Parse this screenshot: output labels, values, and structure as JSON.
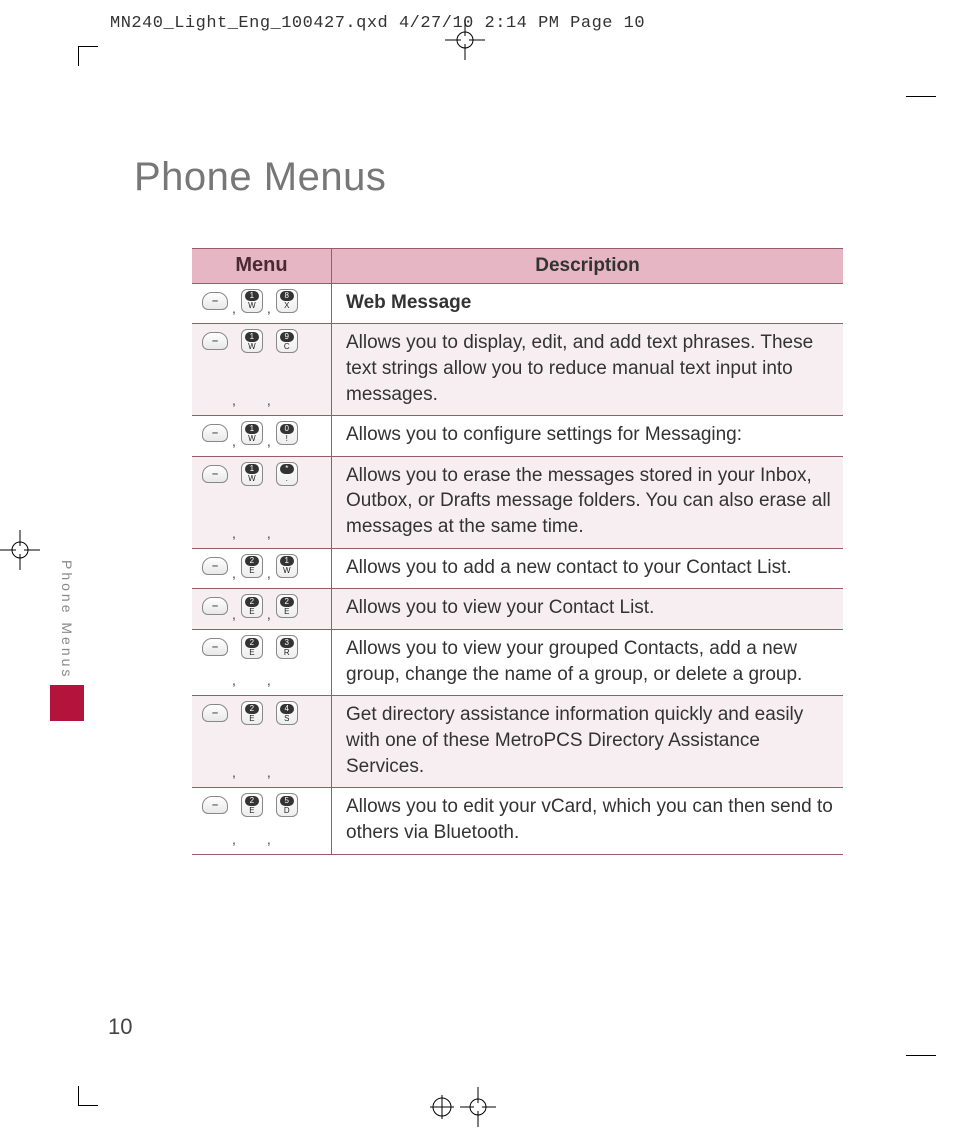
{
  "crop_header": "MN240_Light_Eng_100427.qxd  4/27/10  2:14 PM  Page 10",
  "page_title": "Phone Menus",
  "side_label": "Phone Menus",
  "page_number": "10",
  "table": {
    "header_menu": "Menu",
    "header_desc": "Description",
    "rows": [
      {
        "shaded": false,
        "bold": true,
        "keys": [
          "soft",
          "1W",
          "8X"
        ],
        "desc": "Web Message"
      },
      {
        "shaded": true,
        "bold": false,
        "keys": [
          "soft",
          "1W",
          "9C"
        ],
        "desc": "Allows you to display, edit, and add text phrases. These text strings allow you to reduce manual text input into messages."
      },
      {
        "shaded": false,
        "bold": false,
        "keys": [
          "soft",
          "1W",
          "0!"
        ],
        "desc": "Allows you to configure settings for Messaging:"
      },
      {
        "shaded": true,
        "bold": false,
        "keys": [
          "soft",
          "1W",
          "*."
        ],
        "desc": "Allows you to erase the messages stored in your Inbox, Outbox, or Drafts message folders. You can also erase all messages at the same time."
      },
      {
        "shaded": false,
        "bold": false,
        "keys": [
          "soft",
          "2E",
          "1W"
        ],
        "desc": "Allows you to add a new contact to your Contact List."
      },
      {
        "shaded": true,
        "bold": false,
        "keys": [
          "soft",
          "2E",
          "2E"
        ],
        "desc": "Allows you to view your Contact List."
      },
      {
        "shaded": false,
        "bold": false,
        "keys": [
          "soft",
          "2E",
          "3R"
        ],
        "desc": "Allows you to view your grouped Contacts, add a new group, change the name of a group, or delete a group."
      },
      {
        "shaded": true,
        "bold": false,
        "keys": [
          "soft",
          "2E",
          "4S"
        ],
        "desc": "Get directory assistance information quickly and easily with one of these MetroPCS Directory Assistance Services."
      },
      {
        "shaded": false,
        "bold": false,
        "keys": [
          "soft",
          "2E",
          "5D"
        ],
        "desc": "Allows you to edit your vCard, which you can then send to others via Bluetooth."
      }
    ]
  }
}
